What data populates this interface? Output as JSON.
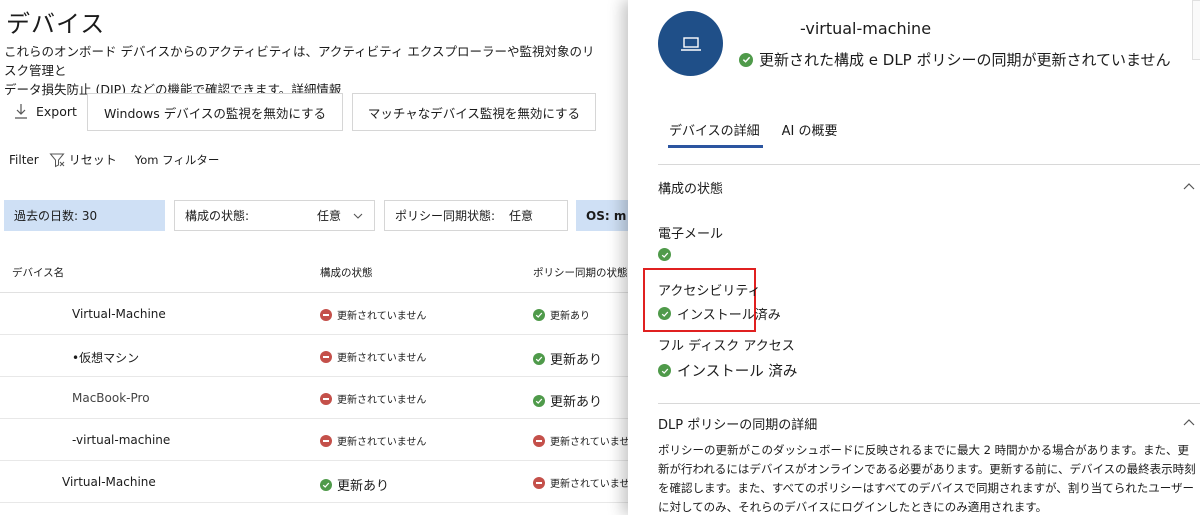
{
  "page": {
    "title": "デバイス",
    "description": "これらのオンボード デバイスからのアクティビティは、アクティビティ エクスプローラーや監視対象のリスク管理と",
    "description2": "データ損失防止 (DIP) などの機能で確認できます。",
    "description_link": "詳細情報"
  },
  "toolbar": {
    "export": "Export",
    "btn_windows": "Windows デバイスの監視を無効にする",
    "btn_mac": "マッチャなデバイス監視を無効にする"
  },
  "filterbar": {
    "filter": "Filter",
    "reset": "リセット",
    "yom": "Yom フィルター"
  },
  "chips": {
    "days": "過去の日数: 30",
    "config_label": "構成の状態:",
    "config_value": "任意",
    "policy_label": "ポリシー同期状態:",
    "policy_value": "任意",
    "os": "OS: m"
  },
  "table": {
    "headers": [
      "デバイス名",
      "構成の状態",
      "ポリシー同期の状態"
    ],
    "rows": [
      {
        "name": "Virtual-Machine",
        "config": "更新されていません",
        "config_status": "red",
        "policy": "更新あり",
        "policy_status": "green"
      },
      {
        "name": "•仮想マシン",
        "config": "更新されていません",
        "config_status": "red",
        "policy": "更新あり",
        "policy_status": "green"
      },
      {
        "name": "MacBook-Pro",
        "config": "更新されていません",
        "config_status": "red",
        "policy": "更新あり",
        "policy_status": "green"
      },
      {
        "name": "-virtual-machine",
        "config": "更新されていません",
        "config_status": "red",
        "policy": "更新されていません",
        "policy_status": "red"
      },
      {
        "name": "Virtual-Machine",
        "config": "更新あり",
        "config_status": "green",
        "policy": "更新されていません",
        "policy_status": "red"
      }
    ]
  },
  "panel": {
    "title": "-virtual-machine",
    "subtitle": "更新された構成 e DLP ポリシーの同期が更新されていません",
    "tabs": [
      "デバイスの詳細",
      "AI の概要"
    ],
    "section1_title": "構成の状態",
    "email_label": "電子メール",
    "accessibility_label": "アクセシビリティ",
    "accessibility_value": "インストール済み",
    "fulldisk_label": "フル ディスク アクセス",
    "fulldisk_value": "インストール 済み",
    "section2_title": "DLP ポリシーの同期の詳細",
    "section2_text": "ポリシーの更新がこのダッシュボードに反映されるまでに最大 2 時間かかる場合があります。また、更新が行われるにはデバイスがオンラインである必要があります。更新する前に、デバイスの最終表示時刻を確認します。また、すべてのポリシーはすべてのデバイスで同期されますが、割り当てられたユーザーに対してのみ、それらのデバイスにログインしたときにのみ適用されます。"
  },
  "colors": {
    "accent": "#2c55a0",
    "avatar": "#1f4f88",
    "chip_selected": "#cfe0f5",
    "success": "#4f9a4a",
    "error": "#c4504a",
    "highlight": "#e02020"
  }
}
